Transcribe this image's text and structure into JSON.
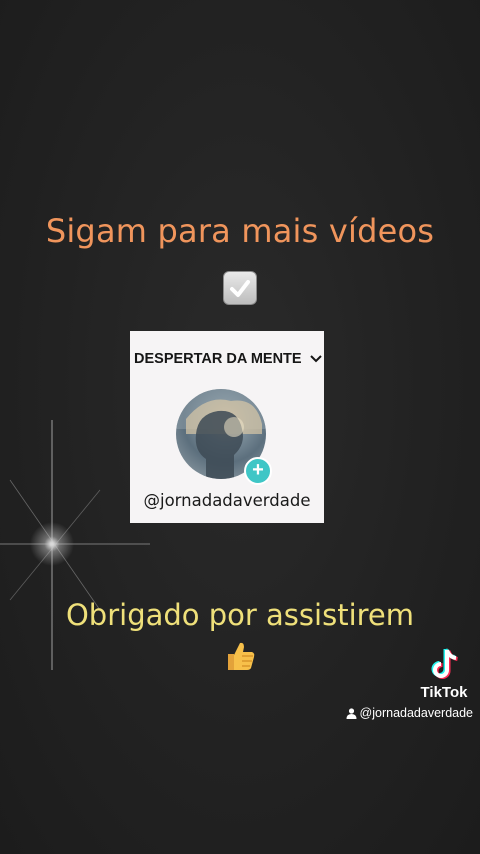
{
  "headline": "Sigam para mais vídeos",
  "check_icon": "check-mark-button-icon",
  "profile_card": {
    "title": "DESPERTAR DA MENTE",
    "dropdown_icon": "chevron-down-icon",
    "avatar_icon": "profile-avatar",
    "follow_icon": "plus-icon",
    "follow_symbol": "+",
    "handle": "@jornadadaverdade"
  },
  "thanks": "Obrigado por assistirem",
  "thumb_icon": "thumbs-up-icon",
  "watermark": {
    "logo_icon": "tiktok-logo-icon",
    "brand": "TikTok",
    "user_icon": "person-icon",
    "username": "@jornadadaverdade"
  },
  "colors": {
    "background": "#222222",
    "headline": "#f0955c",
    "thanks": "#efe07a",
    "follow_badge": "#3fc6c6"
  }
}
